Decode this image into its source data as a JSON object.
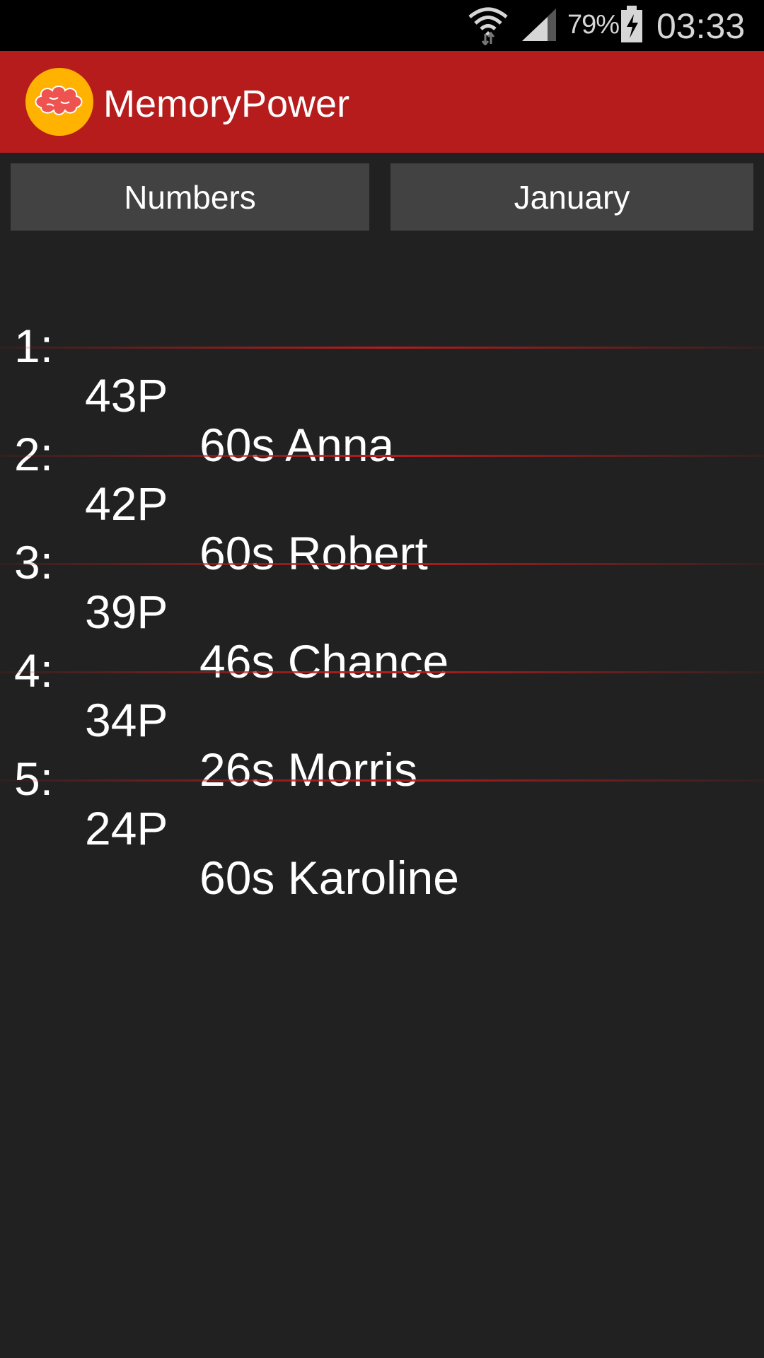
{
  "status_bar": {
    "battery_percent": "79%",
    "time": "03:33",
    "icons": [
      "wifi-icon",
      "signal-icon",
      "battery-charging-icon"
    ]
  },
  "app_bar": {
    "title": "MemoryPower",
    "logo_icon": "brain-icon",
    "color": "#b71c1c",
    "logo_color": "#ffb300"
  },
  "filters": {
    "category": "Numbers",
    "period": "January"
  },
  "scores": [
    {
      "rank": "1:",
      "points": "43P",
      "detail": "60s Anna"
    },
    {
      "rank": "2:",
      "points": "42P",
      "detail": "60s Robert"
    },
    {
      "rank": "3:",
      "points": "39P",
      "detail": "46s Chance"
    },
    {
      "rank": "4:",
      "points": "34P",
      "detail": "26s Morris"
    },
    {
      "rank": "5:",
      "points": "24P",
      "detail": "60s Karoline"
    }
  ]
}
